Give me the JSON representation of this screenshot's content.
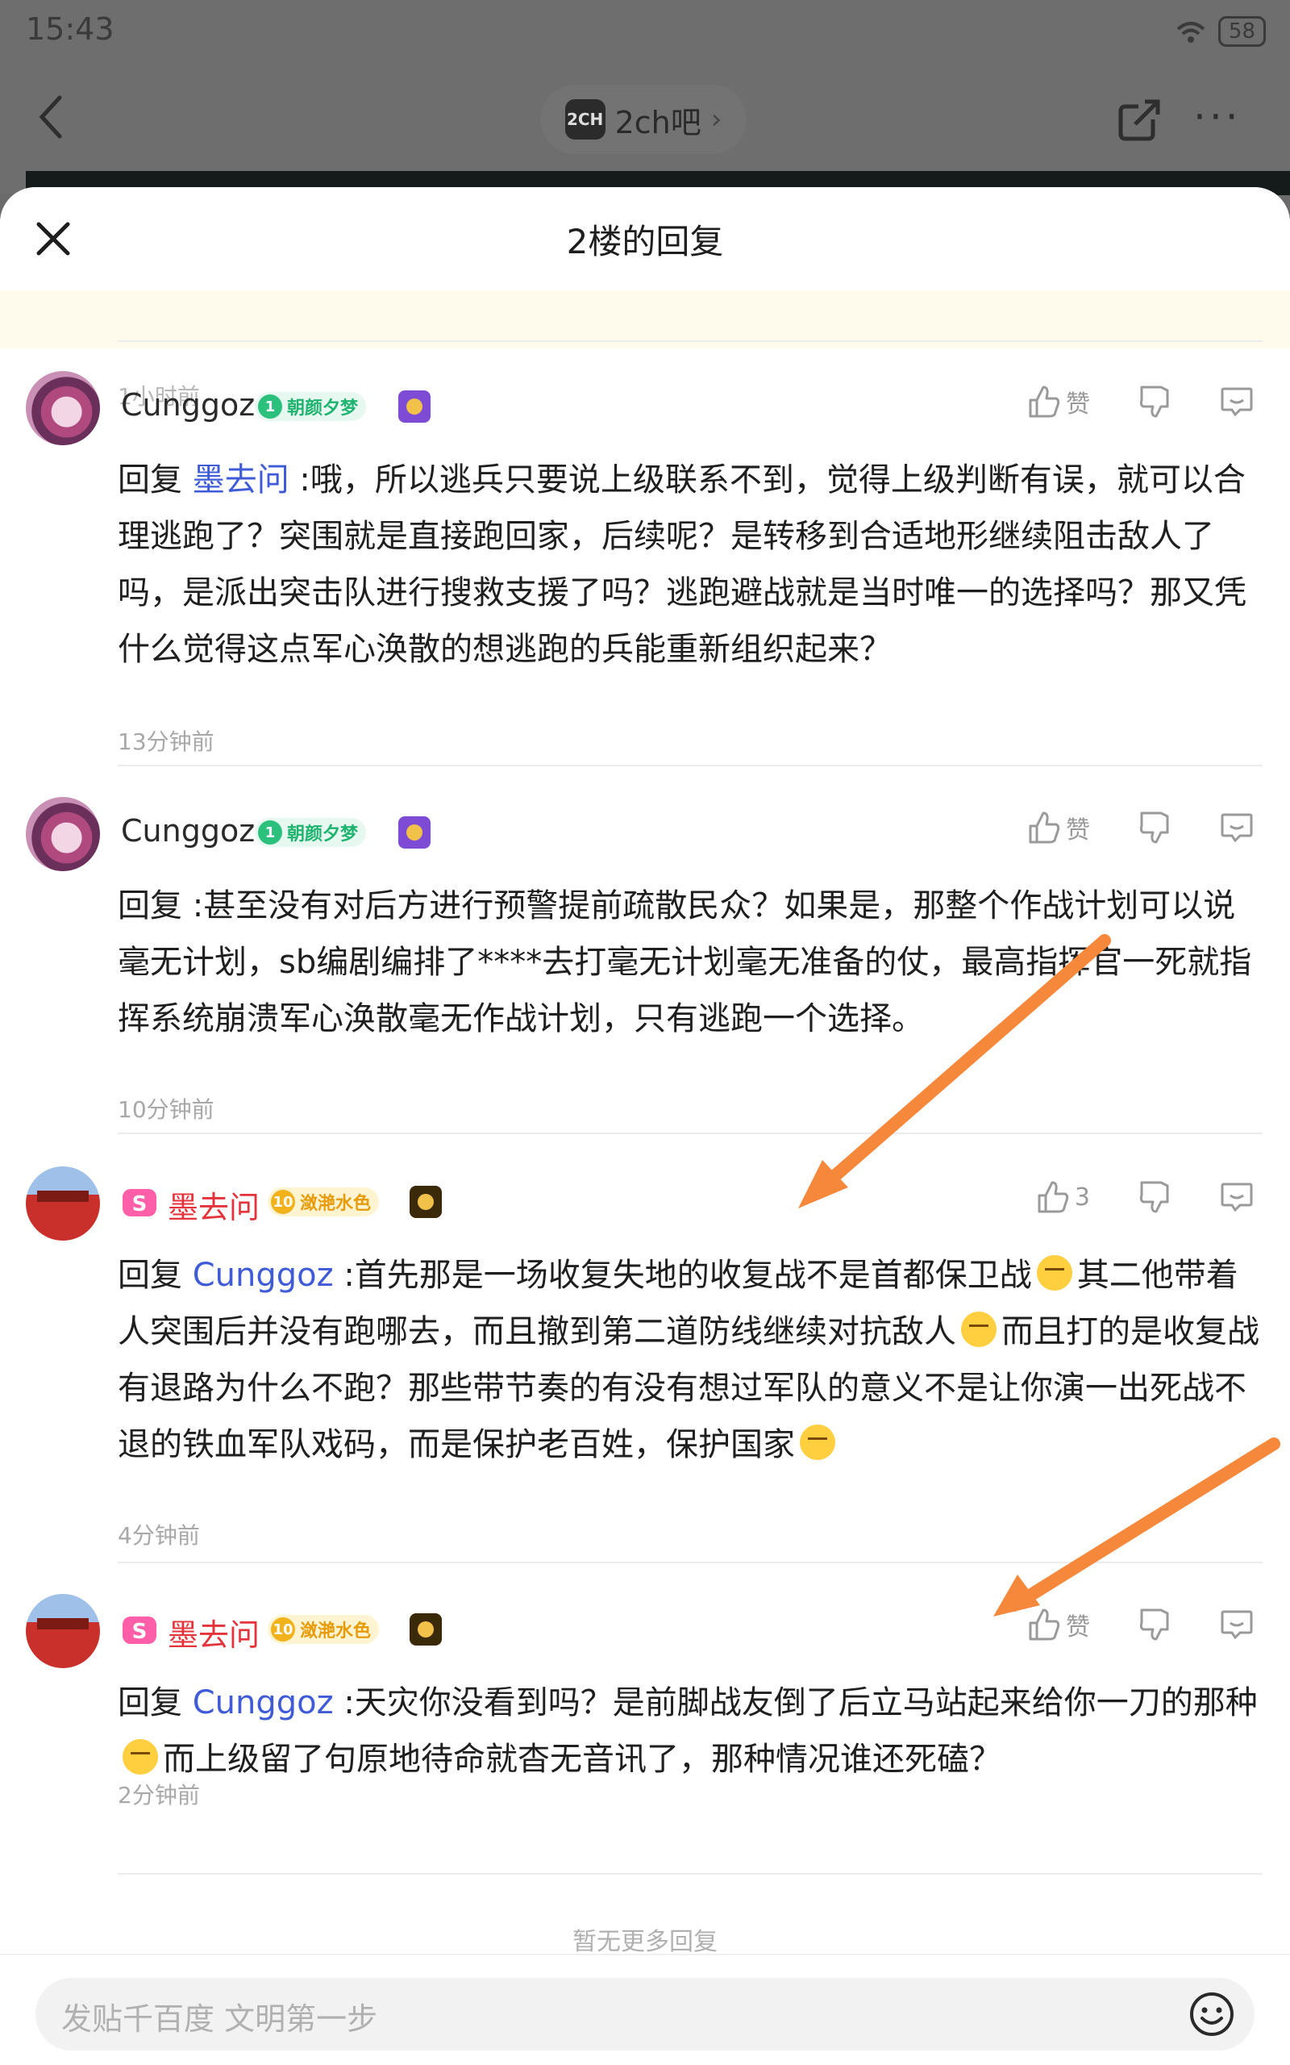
{
  "status_bar": {
    "time": "15:43",
    "battery": "58"
  },
  "app_header": {
    "forum_logo_text": "2CH",
    "forum_name": "2ch吧",
    "forum_chevron": "›"
  },
  "sheet": {
    "title": "2楼的回复",
    "previous_time_fragment": "1小时前"
  },
  "replies": [
    {
      "username": "Cunggoz",
      "badge_level": "1",
      "badge_name": "朝颜夕梦",
      "like_label": "赞",
      "reply_prefix": "回复 ",
      "mention": "墨去问",
      "text": " :哦，所以逃兵只要说上级联系不到，觉得上级判断有误，就可以合理逃跑了？突围就是直接跑回家，后续呢？是转移到合适地形继续阻击敌人了吗，是派出突击队进行搜救支援了吗？逃跑避战就是当时唯一的选择吗？那又凭什么觉得这点军心涣散的想逃跑的兵能重新组织起来？",
      "time": "13分钟前"
    },
    {
      "username": "Cunggoz",
      "badge_level": "1",
      "badge_name": "朝颜夕梦",
      "like_label": "赞",
      "reply_prefix": "回复 ",
      "text": " :甚至没有对后方进行预警提前疏散民众？如果是，那整个作战计划可以说毫无计划，sb编剧编排了****去打毫无计划毫无准备的仗，最高指挥官一死就指挥系统崩溃军心涣散毫无作战计划，只有逃跑一个选择。",
      "time": "10分钟前"
    },
    {
      "username": "墨去问",
      "badge_level": "10",
      "badge_name": "潋滟水色",
      "like_count": "3",
      "reply_prefix": "回复 ",
      "mention": "Cunggoz",
      "text_1": " :首先那是一场收复失地的收复战不是首都保卫战",
      "text_2": "其二他带着人突围后并没有跑哪去，而且撤到第二道防线继续对抗敌人",
      "text_3": "而且打的是收复战有退路为什么不跑？那些带节奏的有没有想过军队的意义不是让你演一出死战不退的铁血军队戏码，而是保护老百姓，保护国家",
      "time": "4分钟前"
    },
    {
      "username": "墨去问",
      "badge_level": "10",
      "badge_name": "潋滟水色",
      "like_label": "赞",
      "reply_prefix": "回复 ",
      "mention": "Cunggoz",
      "text_1": " :天灾你没看到吗？是前脚战友倒了后立马站起来给你一刀的那种",
      "text_2": "而上级留了句原地待命就杳无音讯了，那种情况谁还死磕？",
      "time": "2分钟前"
    }
  ],
  "footer": {
    "no_more": "暂无更多回复",
    "input_placeholder": "发贴千百度 文明第一步"
  },
  "colors": {
    "mention": "#3f5bd8",
    "username_red": "#e5333b",
    "arrow": "#f5883a"
  }
}
